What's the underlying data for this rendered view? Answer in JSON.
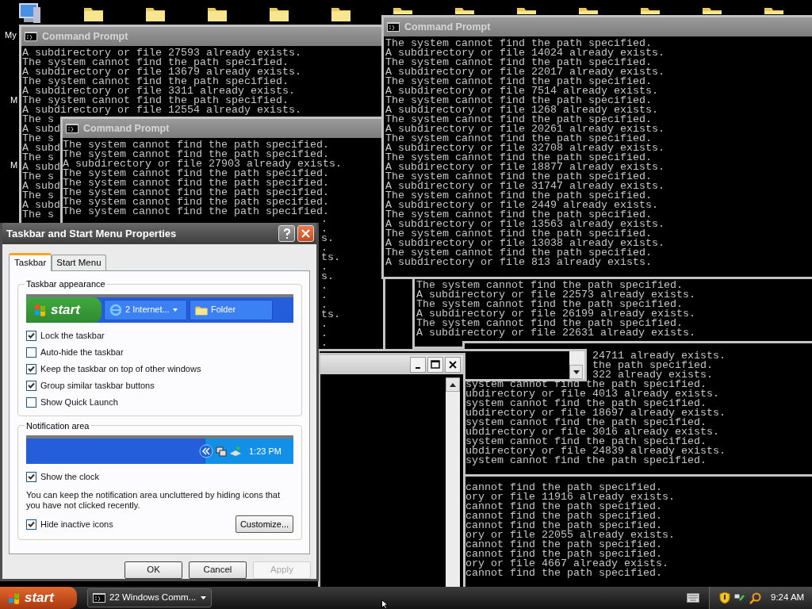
{
  "desktop": {
    "icons": [
      {
        "kind": "computer"
      },
      {
        "kind": "folder"
      },
      {
        "kind": "folder"
      },
      {
        "kind": "folder"
      },
      {
        "kind": "folder"
      },
      {
        "kind": "folder"
      },
      {
        "kind": "folder"
      },
      {
        "kind": "folder"
      },
      {
        "kind": "folder"
      },
      {
        "kind": "folder"
      },
      {
        "kind": "folder"
      },
      {
        "kind": "folder"
      },
      {
        "kind": "folder"
      }
    ],
    "labels": [
      "My",
      "M",
      "M"
    ]
  },
  "windows": [
    {
      "kind": "titled",
      "title": "Command Prompt",
      "lines": [
        "A subdirectory or file 27593 already exists.",
        "The system cannot find the path specified.",
        "A subdirectory or file 13679 already exists.",
        "The system cannot find the path specified.",
        "A subdirectory or file 3311 already exists.",
        "The system cannot find the path specified.",
        "A subdirectory or file 12554 already exists.",
        "The s",
        "A subd",
        "The s",
        "A subd",
        "The s",
        "A subd",
        "The s",
        "A subd",
        "The s",
        "A subd",
        "The s"
      ]
    },
    {
      "kind": "titled",
      "title": "Command Prompt",
      "lines": [
        "The system cannot find the path specified.",
        "The system cannot find the path specified.",
        "A subdirectory or file 27903 already exists.",
        "The system cannot find the path specified.",
        "The system cannot find the path specified.",
        "The system cannot find the path specified.",
        "The system cannot find the path specified.",
        "The system cannot find the path specified."
      ],
      "line_ends": [
        ".",
        ".",
        "s.",
        ".",
        "ts.",
        ".",
        "s.",
        ".",
        ".",
        ".",
        "ts.",
        ".",
        ".",
        "."
      ]
    },
    {
      "kind": "plain",
      "lines": [
        "The system cannot find the path specified.",
        "A subdirectory or file 22573 already exists.",
        "The system cannot find the path specified.",
        "A subdirectory or file 26199 already exists.",
        "The system cannot find the path specified.",
        "A subdirectory or file 22631 already exists."
      ]
    },
    {
      "kind": "titled",
      "title": "Command Prompt",
      "lines": [
        "The system cannot find the path specified.",
        "A subdirectory or file 14024 already exists.",
        "The system cannot find the path specified.",
        "A subdirectory or file 22017 already exists.",
        "The system cannot find the path specified.",
        "A subdirectory or file 7514 already exists.",
        "The system cannot find the path specified.",
        "A subdirectory or file 1268 already exists.",
        "The system cannot find the path specified.",
        "A subdirectory or file 20261 already exists.",
        "The system cannot find the path specified.",
        "A subdirectory or file 32708 already exists.",
        "The system cannot find the path specified.",
        "A subdirectory or file 18877 already exists.",
        "The system cannot find the path specified.",
        "A subdirectory or file 31747 already exists.",
        "The system cannot find the path specified.",
        "A subdirectory or file 2449 already exists.",
        "The system cannot find the path specified.",
        "A subdirectory or file 13563 already exists.",
        "The system cannot find the path specified.",
        "A subdirectory or file 13038 already exists.",
        "The system cannot find the path specified.",
        "A subdirectory or file 813 already exists."
      ]
    },
    {
      "kind": "plain",
      "lines": [
        "24711 already exists.",
        "the path specified.",
        "322 already exists.",
        "system cannot find the path specified.",
        "ubdirectory or file 4013 already exists.",
        "system cannot find the path specified.",
        "ubdirectory or file 18697 already exists.",
        "system cannot find the path specified.",
        "ubdirectory or file 3016 already exists.",
        "system cannot find the path specified.",
        "ubdirectory or file 24839 already exists.",
        "system cannot find the path specified."
      ]
    },
    {
      "kind": "plain",
      "lines": [
        "cannot find the path specified.",
        "ory or file 11916 already exists.",
        "cannot find the path specified.",
        "cannot find the path specified.",
        "cannot find the path specified.",
        "ory or file 22055 already exists.",
        "cannot find the path specified.",
        "cannot find the path specified.",
        "ory or file 4667 already exists.",
        "cannot find the path specified."
      ]
    },
    {
      "kind": "scrolled"
    },
    {
      "kind": "controls"
    }
  ],
  "dialog": {
    "title": "Taskbar and Start Menu Properties",
    "tabs": [
      {
        "label": "Taskbar",
        "selected": true
      },
      {
        "label": "Start Menu",
        "selected": false
      }
    ],
    "appearance": {
      "title": "Taskbar appearance",
      "preview": {
        "start": "start",
        "buttons": [
          {
            "kind": "browser",
            "label": "2 Internet..."
          },
          {
            "kind": "folder",
            "label": "Folder"
          }
        ]
      },
      "options": [
        {
          "label": "Lock the taskbar",
          "checked": true
        },
        {
          "label": "Auto-hide the taskbar",
          "checked": false
        },
        {
          "label": "Keep the taskbar on top of other windows",
          "checked": true
        },
        {
          "label": "Group similar taskbar buttons",
          "checked": true
        },
        {
          "label": "Show Quick Launch",
          "checked": false
        }
      ]
    },
    "notification": {
      "title": "Notification area",
      "preview": {
        "time": "1:23 PM"
      },
      "clock_option": {
        "label": "Show the clock",
        "checked": true
      },
      "note": "You can keep the notification area uncluttered by hiding icons that you have not clicked recently.",
      "hide_option": {
        "label": "Hide inactive icons",
        "checked": true
      },
      "button": "Customize..."
    },
    "buttons": [
      {
        "label": "OK",
        "disabled": false
      },
      {
        "label": "Cancel",
        "disabled": false
      },
      {
        "label": "Apply",
        "disabled": true
      }
    ]
  },
  "taskbar": {
    "start": "start",
    "tasks": [
      {
        "label": "22 Windows Comm..."
      }
    ],
    "clock": "9:24 AM"
  }
}
